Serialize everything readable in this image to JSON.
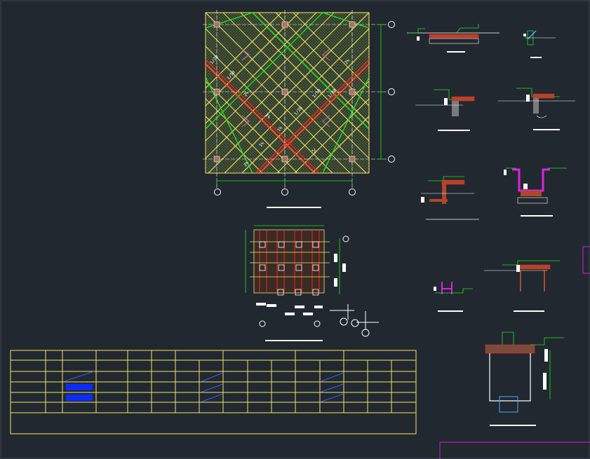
{
  "drawing": {
    "plan_labels": [
      "1/20",
      "1/50",
      "2%",
      "1/20",
      "2%",
      "1/50",
      "1%",
      "1/20",
      "1%",
      "1%",
      "2%",
      "2%"
    ],
    "colors": {
      "background": "#212830",
      "grid_line": "#ffffff",
      "panel_line": "#f5e663",
      "green_line": "#19e619",
      "red_line": "#ff2020",
      "magenta": "#e020e0",
      "brown": "#b0462a",
      "table_line": "#f5e663",
      "title_bar": "#ffffff",
      "frame": "#cc22cc"
    }
  }
}
